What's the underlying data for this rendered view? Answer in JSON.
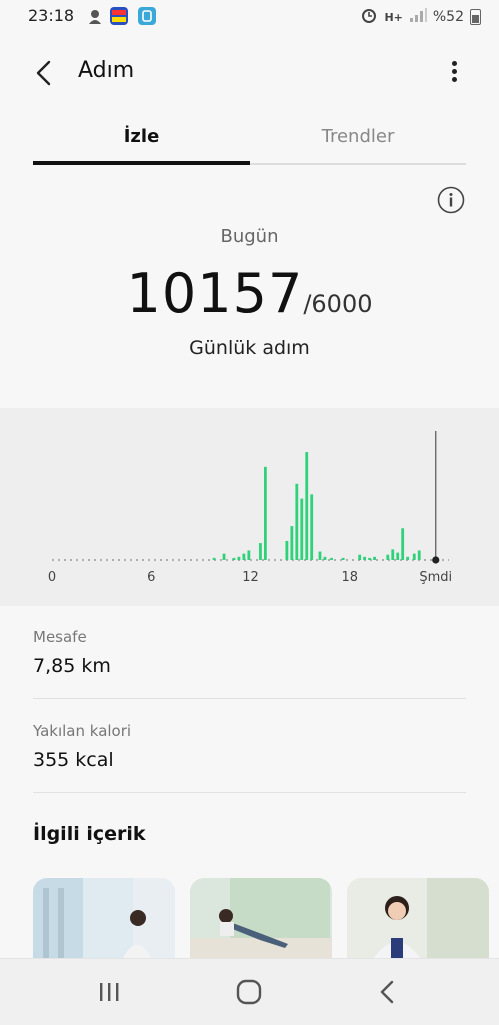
{
  "status_bar": {
    "time": "23:18",
    "battery": "%52"
  },
  "header": {
    "title": "Adım"
  },
  "tabs": [
    {
      "label": "İzle"
    },
    {
      "label": "Trendler"
    }
  ],
  "summary": {
    "period": "Bugün",
    "steps": "10157",
    "goal": "/6000",
    "subtitle": "Günlük adım"
  },
  "chart_data": {
    "type": "bar",
    "x_tick_labels": [
      "0",
      "6",
      "12",
      "18",
      "Şmdi"
    ],
    "x_ticks_hours": [
      0,
      6,
      12,
      18
    ],
    "now_hour": 23.2,
    "bars": [
      {
        "hour": 9.8,
        "value": 2
      },
      {
        "hour": 10.4,
        "value": 6
      },
      {
        "hour": 11.0,
        "value": 2
      },
      {
        "hour": 11.3,
        "value": 3
      },
      {
        "hour": 11.6,
        "value": 6
      },
      {
        "hour": 11.9,
        "value": 9
      },
      {
        "hour": 12.6,
        "value": 16
      },
      {
        "hour": 12.9,
        "value": 88
      },
      {
        "hour": 14.2,
        "value": 18
      },
      {
        "hour": 14.5,
        "value": 32
      },
      {
        "hour": 14.8,
        "value": 72
      },
      {
        "hour": 15.1,
        "value": 58
      },
      {
        "hour": 15.4,
        "value": 102
      },
      {
        "hour": 15.7,
        "value": 62
      },
      {
        "hour": 16.2,
        "value": 8
      },
      {
        "hour": 16.5,
        "value": 3
      },
      {
        "hour": 16.9,
        "value": 2
      },
      {
        "hour": 17.6,
        "value": 2
      },
      {
        "hour": 18.6,
        "value": 5
      },
      {
        "hour": 18.9,
        "value": 3
      },
      {
        "hour": 19.2,
        "value": 2
      },
      {
        "hour": 19.5,
        "value": 3
      },
      {
        "hour": 20.3,
        "value": 5
      },
      {
        "hour": 20.6,
        "value": 10
      },
      {
        "hour": 20.9,
        "value": 7
      },
      {
        "hour": 21.2,
        "value": 30
      },
      {
        "hour": 21.5,
        "value": 3
      },
      {
        "hour": 21.9,
        "value": 6
      },
      {
        "hour": 22.2,
        "value": 9
      }
    ],
    "ylim": [
      0,
      120
    ],
    "colors": {
      "bar": "#2fd27a",
      "axis": "#9a9a9a",
      "now_line": "#555555"
    }
  },
  "stats": [
    {
      "label": "Mesafe",
      "value": "7,85 km"
    },
    {
      "label": "Yakılan kalori",
      "value": "355 kcal"
    }
  ],
  "related": {
    "title": "İlgili içerik"
  },
  "icons": [
    "back-arrow-icon",
    "more-vert-icon",
    "info-icon",
    "recents-icon",
    "home-icon",
    "back-nav-icon"
  ]
}
